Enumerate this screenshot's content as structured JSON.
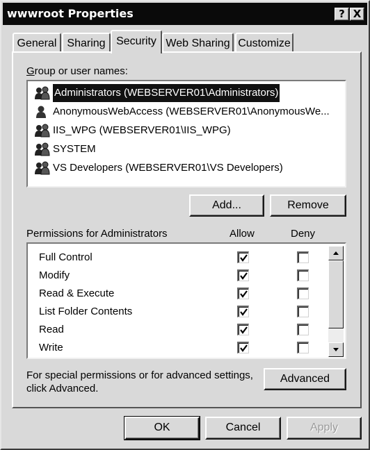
{
  "window": {
    "title": "wwwroot Properties",
    "help_button": "?",
    "close_button": "X"
  },
  "tabs": [
    {
      "label": "General",
      "active": false
    },
    {
      "label": "Sharing",
      "active": false
    },
    {
      "label": "Security",
      "active": true
    },
    {
      "label": "Web Sharing",
      "active": false
    },
    {
      "label": "Customize",
      "active": false
    }
  ],
  "security": {
    "group_label": "Group or user names:",
    "users": [
      {
        "name": "Administrators (WEBSERVER01\\Administrators)",
        "icon": "group-icon",
        "selected": true
      },
      {
        "name": "AnonymousWebAccess (WEBSERVER01\\AnonymousWe...",
        "icon": "user-icon",
        "selected": false
      },
      {
        "name": "IIS_WPG (WEBSERVER01\\IIS_WPG)",
        "icon": "group-icon",
        "selected": false
      },
      {
        "name": "SYSTEM",
        "icon": "group-icon",
        "selected": false
      },
      {
        "name": "VS Developers (WEBSERVER01\\VS Developers)",
        "icon": "group-icon",
        "selected": false
      }
    ],
    "add_button": "Add...",
    "remove_button": "Remove",
    "permissions_label": "Permissions for Administrators",
    "allow_header": "Allow",
    "deny_header": "Deny",
    "permissions": [
      {
        "name": "Full Control",
        "allow": true,
        "deny": false
      },
      {
        "name": "Modify",
        "allow": true,
        "deny": false
      },
      {
        "name": "Read & Execute",
        "allow": true,
        "deny": false
      },
      {
        "name": "List Folder Contents",
        "allow": true,
        "deny": false
      },
      {
        "name": "Read",
        "allow": true,
        "deny": false
      },
      {
        "name": "Write",
        "allow": true,
        "deny": false
      }
    ],
    "special_text_line1": "For special permissions or for advanced settings,",
    "special_text_line2": "click Advanced.",
    "advanced_button": "Advanced"
  },
  "footer": {
    "ok_button": "OK",
    "cancel_button": "Cancel",
    "apply_button": "Apply"
  }
}
